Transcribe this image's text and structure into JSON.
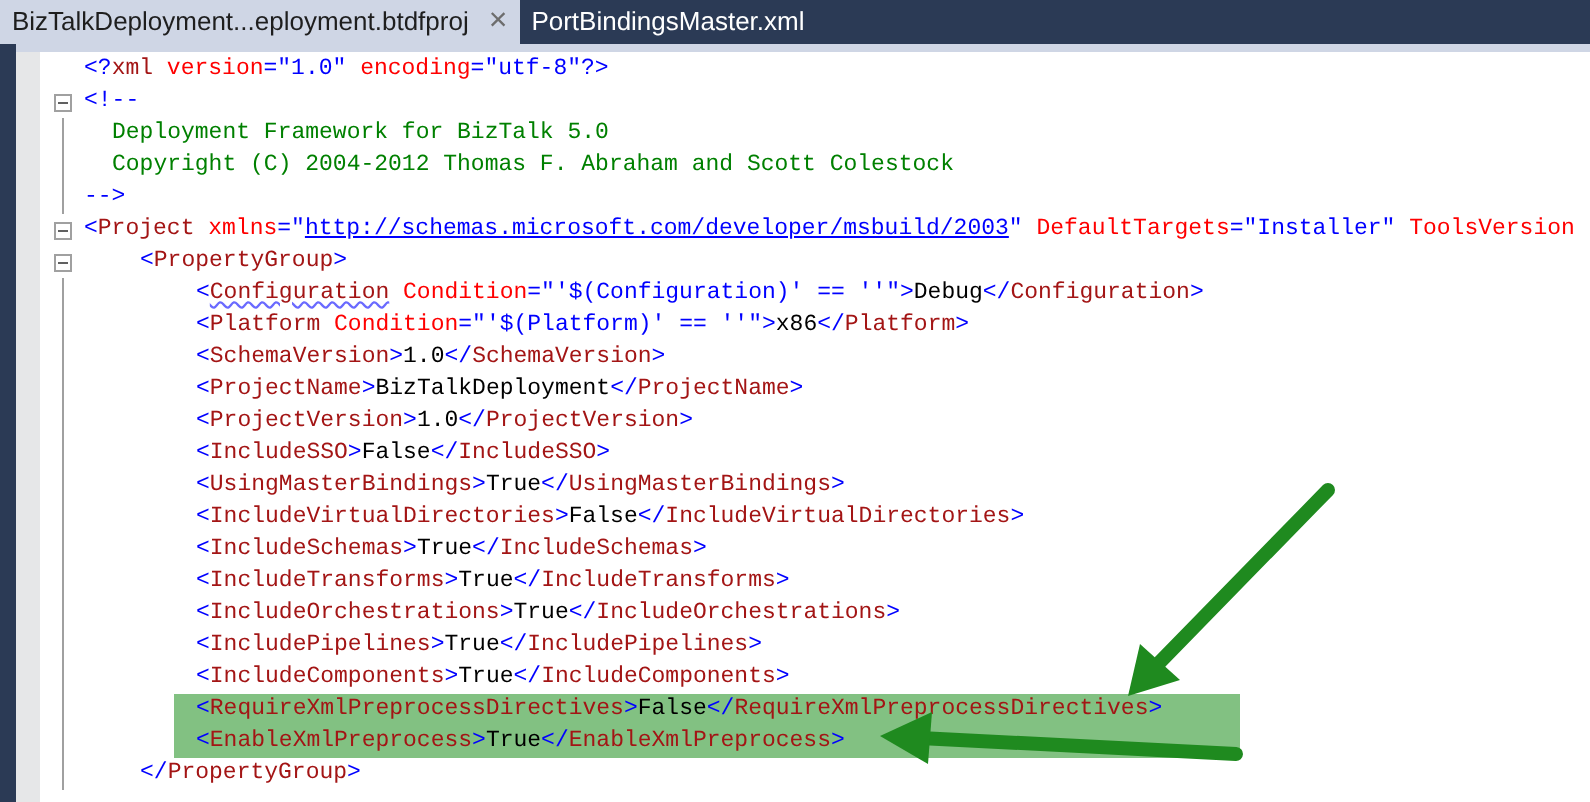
{
  "tabs": [
    {
      "label": "BizTalkDeployment...eployment.btdfproj",
      "selected": true,
      "close": "×"
    },
    {
      "label": "PortBindingsMaster.xml",
      "selected": false
    }
  ],
  "editor": {
    "lines": [
      {
        "tokens": [
          {
            "kind": "punct",
            "text": "<?"
          },
          {
            "kind": "tag",
            "text": "xml"
          },
          {
            "kind": "attr",
            "text": " version"
          },
          {
            "kind": "punct",
            "text": "="
          },
          {
            "kind": "val",
            "text": "\"1.0\""
          },
          {
            "kind": "attr",
            "text": " encoding"
          },
          {
            "kind": "punct",
            "text": "="
          },
          {
            "kind": "val",
            "text": "\"utf-8\""
          },
          {
            "kind": "punct",
            "text": "?>"
          }
        ]
      },
      {
        "tokens": [
          {
            "kind": "punct",
            "text": "<!--"
          }
        ],
        "expanded": true,
        "children": [
          {
            "kind": "body",
            "tokens": [
              {
                "kind": "comment",
                "text": "Deployment Framework for BizTalk 5.0"
              }
            ]
          },
          {
            "kind": "body",
            "tokens": [
              {
                "kind": "comment",
                "text": "Copyright (C) 2004-2012 Thomas F. Abraham and Scott Colestock"
              }
            ]
          },
          {
            "kind": "close",
            "tokens": [
              {
                "kind": "punct",
                "text": "-->"
              }
            ]
          }
        ]
      },
      {
        "tokens": [
          {
            "kind": "punct",
            "text": "<"
          },
          {
            "kind": "tag",
            "text": "Project"
          },
          {
            "kind": "attr",
            "text": " xmlns"
          },
          {
            "kind": "punct",
            "text": "="
          },
          {
            "kind": "val",
            "text": "\""
          },
          {
            "kind": "link",
            "text": "http://schemas.microsoft.com/developer/msbuild/2003"
          },
          {
            "kind": "val",
            "text": "\""
          },
          {
            "kind": "attr",
            "text": " DefaultTargets"
          },
          {
            "kind": "punct",
            "text": "="
          },
          {
            "kind": "val",
            "text": "\"Installer\""
          },
          {
            "kind": "attr",
            "text": " ToolsVersion"
          }
        ],
        "expanded": true,
        "children": [
          {
            "tokens": [
              {
                "kind": "punct",
                "text": "<"
              },
              {
                "kind": "tag",
                "text": "PropertyGroup"
              },
              {
                "kind": "punct",
                "text": ">"
              }
            ],
            "expanded": true,
            "children": [
              {
                "highlighted": false,
                "tokens": [
                  {
                    "kind": "punct",
                    "text": "<"
                  },
                  {
                    "kind": "warn",
                    "text": "Configuration"
                  },
                  {
                    "kind": "attr",
                    "text": " Condition"
                  },
                  {
                    "kind": "punct",
                    "text": "="
                  },
                  {
                    "kind": "val",
                    "text": "\"'$(Configuration)' == ''\""
                  },
                  {
                    "kind": "punct",
                    "text": ">"
                  },
                  {
                    "kind": "text",
                    "text": "Debug"
                  },
                  {
                    "kind": "punct",
                    "text": "</"
                  },
                  {
                    "kind": "tag",
                    "text": "Configuration"
                  },
                  {
                    "kind": "punct",
                    "text": ">"
                  }
                ]
              },
              {
                "highlighted": false,
                "tokens": [
                  {
                    "kind": "punct",
                    "text": "<"
                  },
                  {
                    "kind": "tag",
                    "text": "Platform"
                  },
                  {
                    "kind": "attr",
                    "text": " Condition"
                  },
                  {
                    "kind": "punct",
                    "text": "="
                  },
                  {
                    "kind": "val",
                    "text": "\"'$(Platform)' == ''\""
                  },
                  {
                    "kind": "punct",
                    "text": ">"
                  },
                  {
                    "kind": "text",
                    "text": "x86"
                  },
                  {
                    "kind": "punct",
                    "text": "</"
                  },
                  {
                    "kind": "tag",
                    "text": "Platform"
                  },
                  {
                    "kind": "punct",
                    "text": ">"
                  }
                ]
              },
              {
                "highlighted": false,
                "tokens": [
                  {
                    "kind": "punct",
                    "text": "<"
                  },
                  {
                    "kind": "tag",
                    "text": "SchemaVersion"
                  },
                  {
                    "kind": "punct",
                    "text": ">"
                  },
                  {
                    "kind": "text",
                    "text": "1.0"
                  },
                  {
                    "kind": "punct",
                    "text": "</"
                  },
                  {
                    "kind": "tag",
                    "text": "SchemaVersion"
                  },
                  {
                    "kind": "punct",
                    "text": ">"
                  }
                ]
              },
              {
                "highlighted": false,
                "tokens": [
                  {
                    "kind": "punct",
                    "text": "<"
                  },
                  {
                    "kind": "tag",
                    "text": "ProjectName"
                  },
                  {
                    "kind": "punct",
                    "text": ">"
                  },
                  {
                    "kind": "text",
                    "text": "BizTalkDeployment"
                  },
                  {
                    "kind": "punct",
                    "text": "</"
                  },
                  {
                    "kind": "tag",
                    "text": "ProjectName"
                  },
                  {
                    "kind": "punct",
                    "text": ">"
                  }
                ]
              },
              {
                "highlighted": false,
                "tokens": [
                  {
                    "kind": "punct",
                    "text": "<"
                  },
                  {
                    "kind": "tag",
                    "text": "ProjectVersion"
                  },
                  {
                    "kind": "punct",
                    "text": ">"
                  },
                  {
                    "kind": "text",
                    "text": "1.0"
                  },
                  {
                    "kind": "punct",
                    "text": "</"
                  },
                  {
                    "kind": "tag",
                    "text": "ProjectVersion"
                  },
                  {
                    "kind": "punct",
                    "text": ">"
                  }
                ]
              },
              {
                "highlighted": false,
                "tokens": [
                  {
                    "kind": "punct",
                    "text": "<"
                  },
                  {
                    "kind": "tag",
                    "text": "IncludeSSO"
                  },
                  {
                    "kind": "punct",
                    "text": ">"
                  },
                  {
                    "kind": "text",
                    "text": "False"
                  },
                  {
                    "kind": "punct",
                    "text": "</"
                  },
                  {
                    "kind": "tag",
                    "text": "IncludeSSO"
                  },
                  {
                    "kind": "punct",
                    "text": ">"
                  }
                ]
              },
              {
                "highlighted": false,
                "tokens": [
                  {
                    "kind": "punct",
                    "text": "<"
                  },
                  {
                    "kind": "tag",
                    "text": "UsingMasterBindings"
                  },
                  {
                    "kind": "punct",
                    "text": ">"
                  },
                  {
                    "kind": "text",
                    "text": "True"
                  },
                  {
                    "kind": "punct",
                    "text": "</"
                  },
                  {
                    "kind": "tag",
                    "text": "UsingMasterBindings"
                  },
                  {
                    "kind": "punct",
                    "text": ">"
                  }
                ]
              },
              {
                "highlighted": false,
                "tokens": [
                  {
                    "kind": "punct",
                    "text": "<"
                  },
                  {
                    "kind": "tag",
                    "text": "IncludeVirtualDirectories"
                  },
                  {
                    "kind": "punct",
                    "text": ">"
                  },
                  {
                    "kind": "text",
                    "text": "False"
                  },
                  {
                    "kind": "punct",
                    "text": "</"
                  },
                  {
                    "kind": "tag",
                    "text": "IncludeVirtualDirectories"
                  },
                  {
                    "kind": "punct",
                    "text": ">"
                  }
                ]
              },
              {
                "highlighted": false,
                "tokens": [
                  {
                    "kind": "punct",
                    "text": "<"
                  },
                  {
                    "kind": "tag",
                    "text": "IncludeSchemas"
                  },
                  {
                    "kind": "punct",
                    "text": ">"
                  },
                  {
                    "kind": "text",
                    "text": "True"
                  },
                  {
                    "kind": "punct",
                    "text": "</"
                  },
                  {
                    "kind": "tag",
                    "text": "IncludeSchemas"
                  },
                  {
                    "kind": "punct",
                    "text": ">"
                  }
                ]
              },
              {
                "highlighted": false,
                "tokens": [
                  {
                    "kind": "punct",
                    "text": "<"
                  },
                  {
                    "kind": "tag",
                    "text": "IncludeTransforms"
                  },
                  {
                    "kind": "punct",
                    "text": ">"
                  },
                  {
                    "kind": "text",
                    "text": "True"
                  },
                  {
                    "kind": "punct",
                    "text": "</"
                  },
                  {
                    "kind": "tag",
                    "text": "IncludeTransforms"
                  },
                  {
                    "kind": "punct",
                    "text": ">"
                  }
                ]
              },
              {
                "highlighted": false,
                "tokens": [
                  {
                    "kind": "punct",
                    "text": "<"
                  },
                  {
                    "kind": "tag",
                    "text": "IncludeOrchestrations"
                  },
                  {
                    "kind": "punct",
                    "text": ">"
                  },
                  {
                    "kind": "text",
                    "text": "True"
                  },
                  {
                    "kind": "punct",
                    "text": "</"
                  },
                  {
                    "kind": "tag",
                    "text": "IncludeOrchestrations"
                  },
                  {
                    "kind": "punct",
                    "text": ">"
                  }
                ]
              },
              {
                "highlighted": false,
                "tokens": [
                  {
                    "kind": "punct",
                    "text": "<"
                  },
                  {
                    "kind": "tag",
                    "text": "IncludePipelines"
                  },
                  {
                    "kind": "punct",
                    "text": ">"
                  },
                  {
                    "kind": "text",
                    "text": "True"
                  },
                  {
                    "kind": "punct",
                    "text": "</"
                  },
                  {
                    "kind": "tag",
                    "text": "IncludePipelines"
                  },
                  {
                    "kind": "punct",
                    "text": ">"
                  }
                ]
              },
              {
                "highlighted": false,
                "tokens": [
                  {
                    "kind": "punct",
                    "text": "<"
                  },
                  {
                    "kind": "tag",
                    "text": "IncludeComponents"
                  },
                  {
                    "kind": "punct",
                    "text": ">"
                  },
                  {
                    "kind": "text",
                    "text": "True"
                  },
                  {
                    "kind": "punct",
                    "text": "</"
                  },
                  {
                    "kind": "tag",
                    "text": "IncludeComponents"
                  },
                  {
                    "kind": "punct",
                    "text": ">"
                  }
                ]
              },
              {
                "highlighted": true,
                "tokens": [
                  {
                    "kind": "punct",
                    "text": "<"
                  },
                  {
                    "kind": "tag",
                    "text": "RequireXmlPreprocessDirectives"
                  },
                  {
                    "kind": "punct",
                    "text": ">"
                  },
                  {
                    "kind": "text",
                    "text": "False"
                  },
                  {
                    "kind": "punct",
                    "text": "</"
                  },
                  {
                    "kind": "tag",
                    "text": "RequireXmlPreprocessDirectives"
                  },
                  {
                    "kind": "punct",
                    "text": ">"
                  }
                ]
              },
              {
                "highlighted": true,
                "tokens": [
                  {
                    "kind": "punct",
                    "text": "<"
                  },
                  {
                    "kind": "tag",
                    "text": "EnableXmlPreprocess"
                  },
                  {
                    "kind": "punct",
                    "text": ">"
                  },
                  {
                    "kind": "text",
                    "text": "True"
                  },
                  {
                    "kind": "punct",
                    "text": "</"
                  },
                  {
                    "kind": "tag",
                    "text": "EnableXmlPreprocess"
                  },
                  {
                    "kind": "punct",
                    "text": ">"
                  }
                ]
              }
            ]
          },
          {
            "tokens": [
              {
                "kind": "punct",
                "text": "</"
              },
              {
                "kind": "tag",
                "text": "PropertyGroup"
              },
              {
                "kind": "punct",
                "text": ">"
              }
            ]
          }
        ]
      }
    ]
  }
}
